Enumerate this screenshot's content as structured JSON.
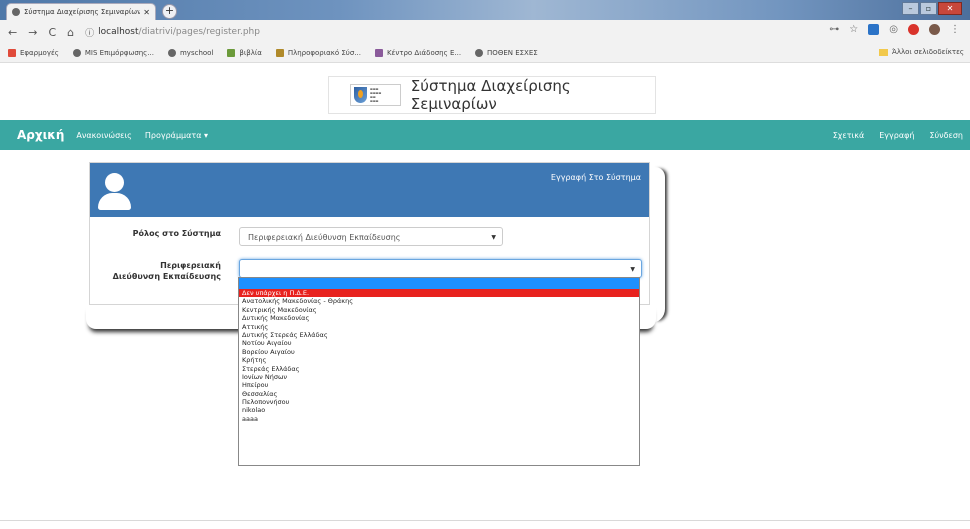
{
  "browser": {
    "tab_title": "Σύστημα Διαχείρισης Σεμιναρίων",
    "url_host": "localhost",
    "url_path": "/diatrivi/pages/register.php",
    "bookmarks": [
      "Εφαρμογές",
      "MIS Επιμόρφωσης...",
      "myschool",
      "βιβλία",
      "Πληροφοριακό Σύσ...",
      "Κέντρο Διάδοσης Ε...",
      "ΠΟΘΕΝ ΕΣΧΕΣ"
    ],
    "other_bookmarks": "Άλλοι σελιδοδείκτες"
  },
  "site": {
    "title": "Σύστημα Διαχείρισης Σεμιναρίων"
  },
  "nav": {
    "brand": "Αρχική",
    "left": [
      "Ανακοινώσεις",
      "Προγράμματα ▾"
    ],
    "right": [
      "Σχετικά",
      "Εγγραφή",
      "Σύνδεση"
    ]
  },
  "panel": {
    "title": "Εγγραφή Στο Σύστημα",
    "role_label": "Ρόλος στο Σύστημα",
    "role_value": "Περιφερειακή Διεύθυνση Εκπαίδευσης",
    "pde_label": "Περιφερειακή Διεύθυνση Εκπαίδευσης",
    "pde_value": ""
  },
  "dropdown": {
    "options": [
      "Δεν υπάρχει η Π.Δ.Ε.",
      "Ανατολικής Μακεδονίας - Θράκης",
      "Κεντρικής Μακεδονίας",
      "Δυτικής Μακεδονίας",
      "Αττικής",
      "Δυτικής Στερεάς Ελλάδας",
      "Νοτίου Αιγαίου",
      "Βορείου Αιγαίου",
      "Κρήτης",
      "Στερεάς Ελλάδας",
      "Ιονίων Νήσων",
      "Ηπείρου",
      "Θεσσαλίας",
      "Πελοποννήσου",
      "nikolao",
      "aaaa"
    ],
    "highlighted": 0
  }
}
